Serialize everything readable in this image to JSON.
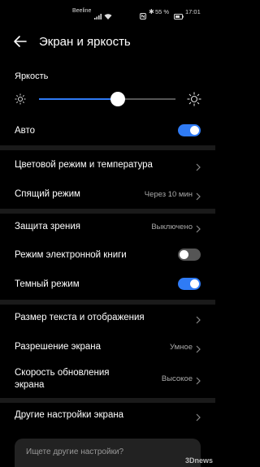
{
  "status_bar": {
    "carrier": "Beeline",
    "battery_text": "55 %",
    "time": "17:01",
    "icons": [
      "signal-icon",
      "wifi-icon",
      "nfc-icon",
      "bluetooth-icon",
      "battery-icon"
    ]
  },
  "header": {
    "title": "Экран и яркость",
    "back_icon": "back-arrow-icon"
  },
  "brightness": {
    "label": "Яркость",
    "level": 0.58
  },
  "rows": {
    "auto": {
      "label": "Авто",
      "toggle": true
    },
    "color_mode": {
      "label": "Цветовой режим и температура"
    },
    "sleep": {
      "label": "Спящий режим",
      "value": "Через 10 мин"
    },
    "eye_comfort": {
      "label": "Защита зрения",
      "value": "Выключено"
    },
    "ebook": {
      "label": "Режим электронной книги",
      "toggle": false
    },
    "dark": {
      "label": "Темный режим",
      "toggle": true
    },
    "text_size": {
      "label": "Размер текста и отображения"
    },
    "resolution": {
      "label": "Разрешение экрана",
      "value": "Умное"
    },
    "refresh": {
      "label_line1": "Скорость обновления",
      "label_line2": "экрана",
      "value": "Высокое"
    },
    "other": {
      "label": "Другие настройки экрана"
    }
  },
  "search": {
    "placeholder": "Ищете другие настройки?"
  },
  "watermark": "3Dnews",
  "colors": {
    "accent": "#2f7bf5",
    "background": "#000000",
    "divider": "#1a1a1a"
  }
}
